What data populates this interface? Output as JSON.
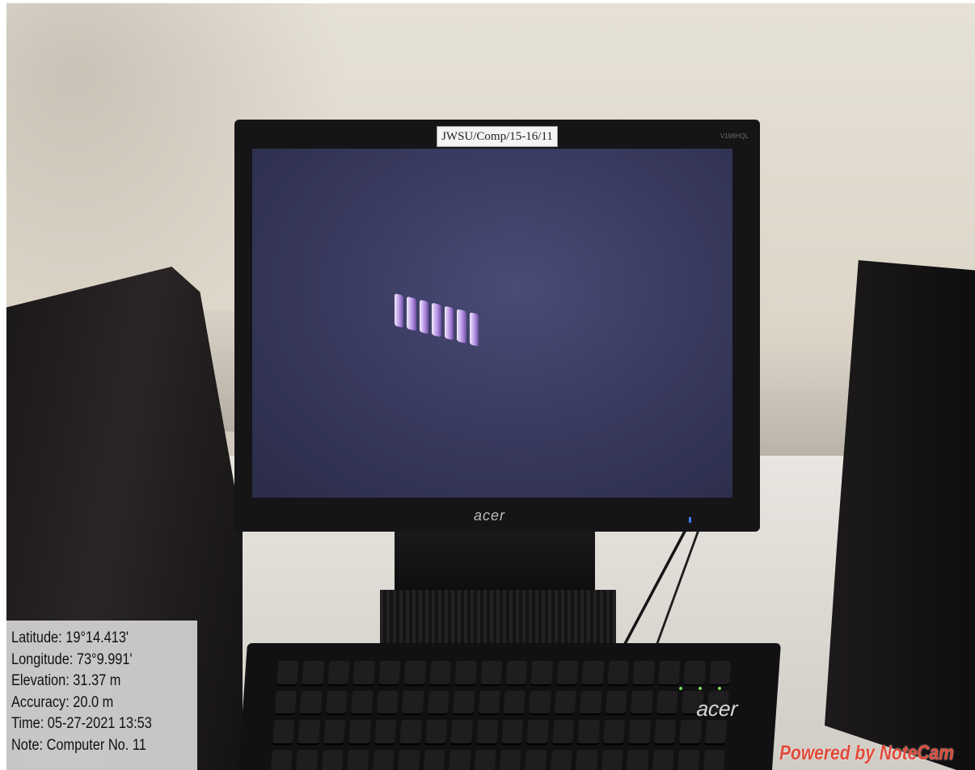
{
  "monitor": {
    "asset_tag": "JWSU/Comp/15-16/11",
    "brand": "acer",
    "model": "V196HQL"
  },
  "keyboard": {
    "brand": "acer"
  },
  "geotag": {
    "latitude": "Latitude: 19°14.413'",
    "longitude": "Longitude: 73°9.991'",
    "elevation": "Elevation: 31.37 m",
    "accuracy": "Accuracy: 20.0 m",
    "time": "Time: 05-27-2021 13:53",
    "note": "Note: Computer No. 11"
  },
  "watermark": "Powered by NoteCam"
}
